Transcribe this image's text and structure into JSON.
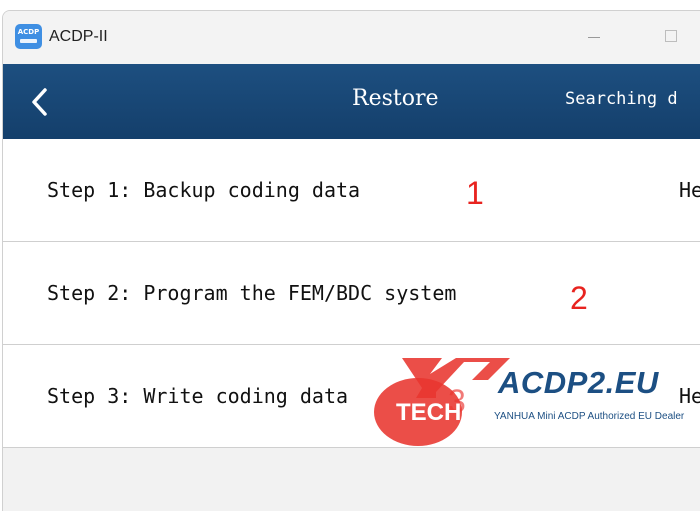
{
  "window": {
    "app_icon_text": "ACDP",
    "app_title": "ACDP-II"
  },
  "navbar": {
    "title": "Restore",
    "status": "Searching d"
  },
  "steps": [
    {
      "label": "Step 1: Backup coding data",
      "help": "He",
      "number": "1"
    },
    {
      "label": "Step 2: Program the FEM/BDC system",
      "help": "",
      "number": "2"
    },
    {
      "label": "Step 3: Write coding data",
      "help": "He",
      "number": "3"
    }
  ],
  "watermark": {
    "brand": "ACDP2.EU",
    "tech": "TECH",
    "tagline": "YANHUA Mini ACDP Authorized EU Dealer"
  },
  "colors": {
    "navbar": "#1b4a78",
    "annotation": "#e8231f",
    "watermark_red": "#e8352f",
    "watermark_blue": "#1c4f83"
  }
}
